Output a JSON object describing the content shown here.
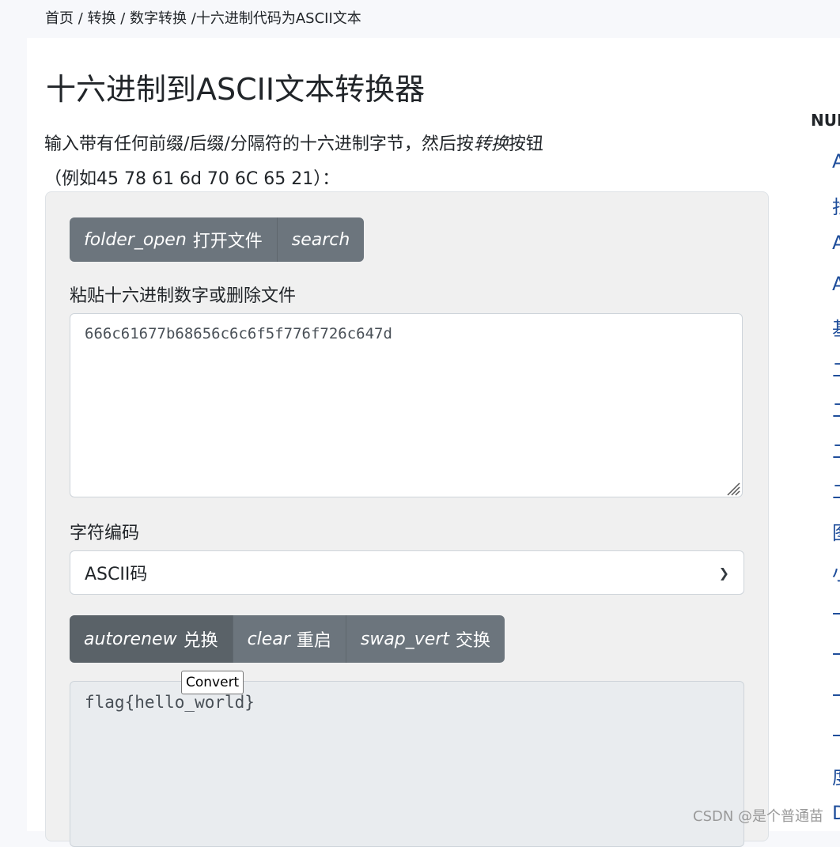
{
  "breadcrumb": {
    "home": "首页",
    "sep1": " / ",
    "convert": "转换",
    "sep2": " / ",
    "number_convert": "数字转换",
    "sep3": " /",
    "current": "十六进制代码为ASCII文本"
  },
  "page": {
    "title": "十六进制到ASCII文本转换器",
    "intro_before": "输入带有任何前缀/后缀/分隔符的十六进制字节，然后按",
    "intro_emphasis": "转换",
    "intro_after": "按钮",
    "intro_example": "（例如45 78 61 6d 70 6C 65 21）："
  },
  "toolbar_top": {
    "open_file_icon": "folder_open",
    "open_file_label": "打开文件",
    "search_icon": "search"
  },
  "input": {
    "label": "粘贴十六进制数字或删除文件",
    "value": "666c61677b68656c6c6f5f776f726c647d"
  },
  "encoding": {
    "label": "字符编码",
    "selected": "ASCII码"
  },
  "toolbar_actions": {
    "convert_icon": "autorenew",
    "convert_label": "兑换",
    "clear_icon": "clear",
    "clear_label": "重启",
    "swap_icon": "swap_vert",
    "swap_label": "交换"
  },
  "tooltip": {
    "text": "Convert"
  },
  "output": {
    "value": "flag{hello_world}"
  },
  "sidebar": {
    "heading": "NUI",
    "items": [
      "A",
      "找",
      "A",
      "A",
      "基",
      "二",
      "二",
      "二",
      "二",
      "图",
      "小",
      "一",
      "一",
      "一",
      "一",
      "度",
      "D"
    ]
  },
  "watermark": {
    "text": "CSDN @是个普通苗"
  }
}
